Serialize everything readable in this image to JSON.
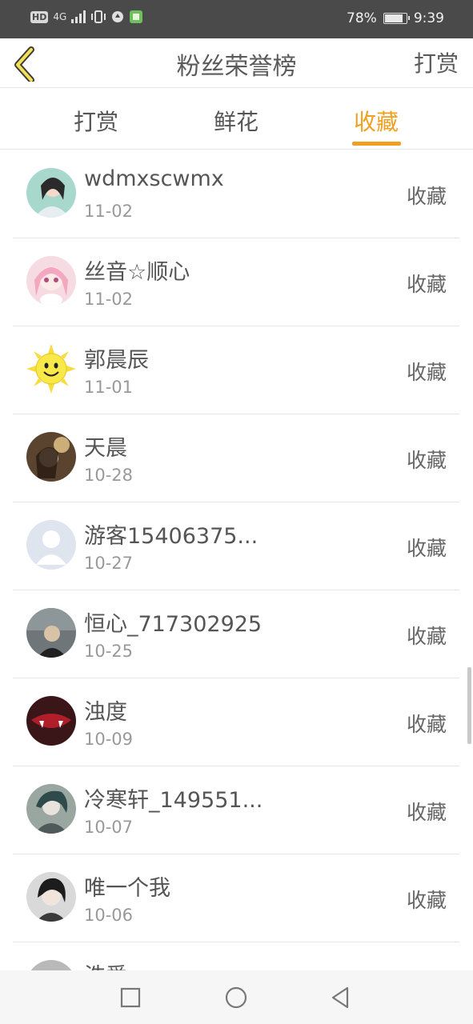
{
  "status_bar": {
    "left_chip": "HD",
    "network": "4G",
    "battery_text": "78%",
    "battery_level": 0.78,
    "time": "9:39"
  },
  "header": {
    "title": "粉丝荣誉榜",
    "action_label": "打赏",
    "back_icon": "chevron-left-icon"
  },
  "tabs": [
    {
      "label": "打赏",
      "active": false
    },
    {
      "label": "鲜花",
      "active": false
    },
    {
      "label": "收藏",
      "active": true
    }
  ],
  "accent_color": "#f0a020",
  "list": [
    {
      "name": "wdmxscwmx",
      "date": "11-02",
      "action": "收藏"
    },
    {
      "name": "丝音☆顺心",
      "date": "11-02",
      "action": "收藏"
    },
    {
      "name": "郭晨辰",
      "date": "11-01",
      "action": "收藏"
    },
    {
      "name": "天晨",
      "date": "10-28",
      "action": "收藏"
    },
    {
      "name": "游客15406375...",
      "date": "10-27",
      "action": "收藏"
    },
    {
      "name": "恒心_717302925",
      "date": "10-25",
      "action": "收藏"
    },
    {
      "name": "浊度",
      "date": "10-09",
      "action": "收藏"
    },
    {
      "name": "冷寒轩_149551...",
      "date": "10-07",
      "action": "收藏"
    },
    {
      "name": "唯一个我",
      "date": "10-06",
      "action": "收藏"
    },
    {
      "name": "浩爱",
      "date": "",
      "action": ""
    }
  ],
  "nav": {
    "recents": "square-icon",
    "home": "circle-icon",
    "back": "triangle-back-icon"
  }
}
